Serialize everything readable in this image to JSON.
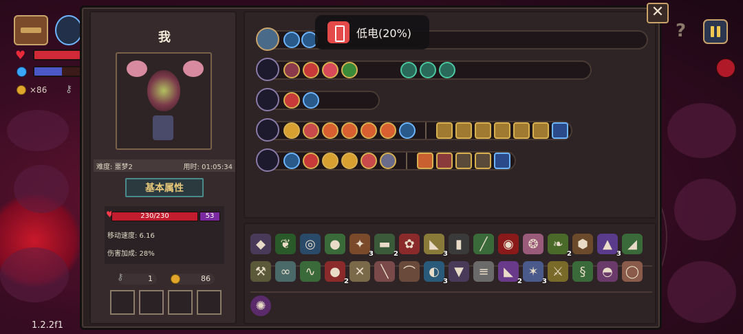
{
  "hud": {
    "coin_count": "×86",
    "version": "1.2.2f1"
  },
  "toast": {
    "text": "低电(20%)"
  },
  "character": {
    "name": "我",
    "difficulty_label": "难度: 噩梦2",
    "time_label": "用时: 01:05:34",
    "attr_button": "基本属性",
    "hp": "230/230",
    "shield": "53",
    "move_speed": "移动速度: 6.16",
    "damage_bonus": "伤害加成: 28%",
    "keys": "1",
    "coins": "86"
  },
  "item_counts": {
    "r1_bomb": "3",
    "r1_shorts": "2",
    "r1_cheese": "3",
    "r1_sprout": "2",
    "r1_hat": "3",
    "r2_red": "2",
    "r2_pendant": "3",
    "r2_boot": "2",
    "r2_star": "3"
  },
  "colors": {
    "panel_bg": "#2a2022",
    "accent_gold": "#d8b050",
    "hp_red": "#c21d2e",
    "shield_purple": "#7a2aa0"
  }
}
